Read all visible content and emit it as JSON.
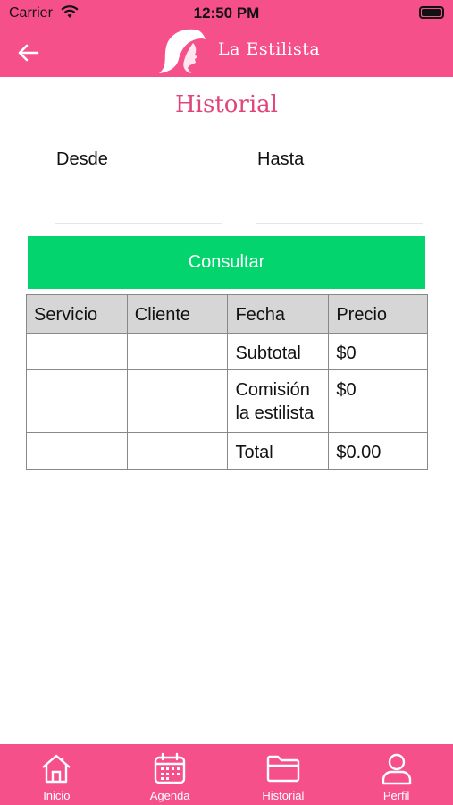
{
  "status_bar": {
    "carrier": "Carrier",
    "time": "12:50 PM"
  },
  "header": {
    "logo_text": "La Estilista"
  },
  "page": {
    "title": "Historial"
  },
  "filters": {
    "desde_label": "Desde",
    "desde_value": "",
    "hasta_label": "Hasta",
    "hasta_value": ""
  },
  "consult_button": {
    "label": "Consultar"
  },
  "table": {
    "headers": [
      "Servicio",
      "Cliente",
      "Fecha",
      "Precio"
    ],
    "rows": [
      {
        "servicio": "",
        "cliente": "",
        "fecha": "Subtotal",
        "precio": "$0"
      },
      {
        "servicio": "",
        "cliente": "",
        "fecha": "Comisión la estilista",
        "precio": "$0"
      },
      {
        "servicio": "",
        "cliente": "",
        "fecha": "Total",
        "precio": "$0.00"
      }
    ]
  },
  "tab_bar": {
    "items": [
      {
        "label": "Inicio",
        "icon": "home-icon"
      },
      {
        "label": "Agenda",
        "icon": "calendar-icon"
      },
      {
        "label": "Historial",
        "icon": "folder-icon"
      },
      {
        "label": "Perfil",
        "icon": "user-icon"
      }
    ]
  },
  "colors": {
    "brand": "#f6508a",
    "title": "#e0447a",
    "button": "#04d46d",
    "table_header": "#d6d6d6"
  }
}
